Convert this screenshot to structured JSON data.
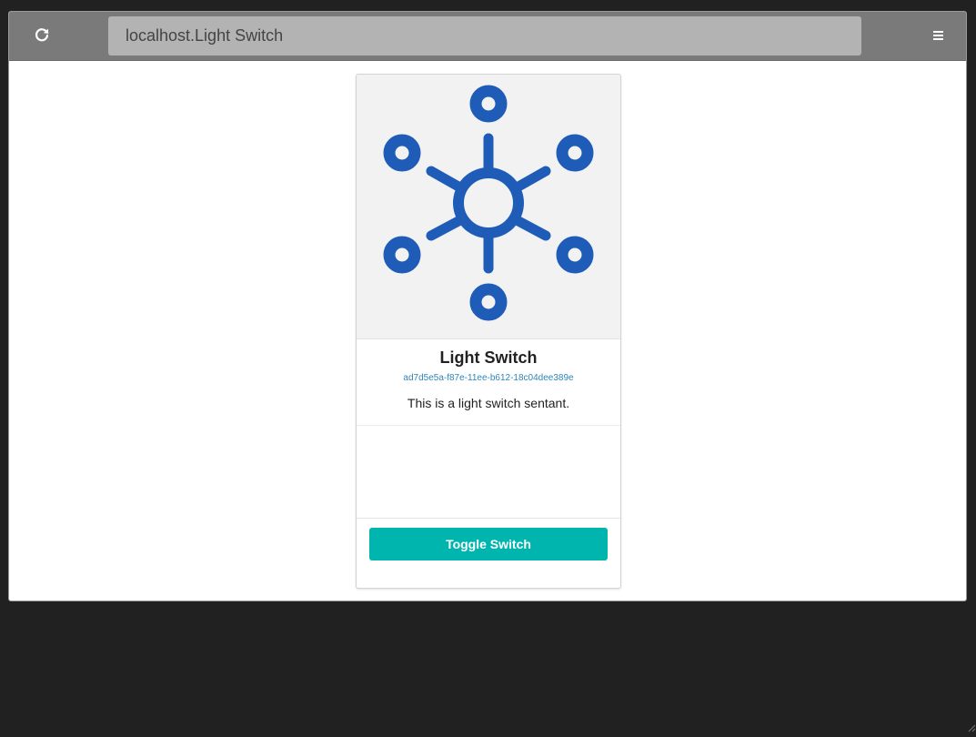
{
  "browser": {
    "url": "localhost.Light Switch",
    "reload_icon": "reload-icon",
    "menu_icon": "hamburger-menu-icon"
  },
  "card": {
    "title": "Light Switch",
    "id": "ad7d5e5a-f87e-11ee-b612-18c04dee389e",
    "description": "This is a light switch sentant.",
    "image_icon": "hub-network-icon",
    "button_label": "Toggle Switch"
  },
  "colors": {
    "accent": "#00b5ad",
    "icon": "#1f5cb8",
    "link": "#2f86b8"
  }
}
